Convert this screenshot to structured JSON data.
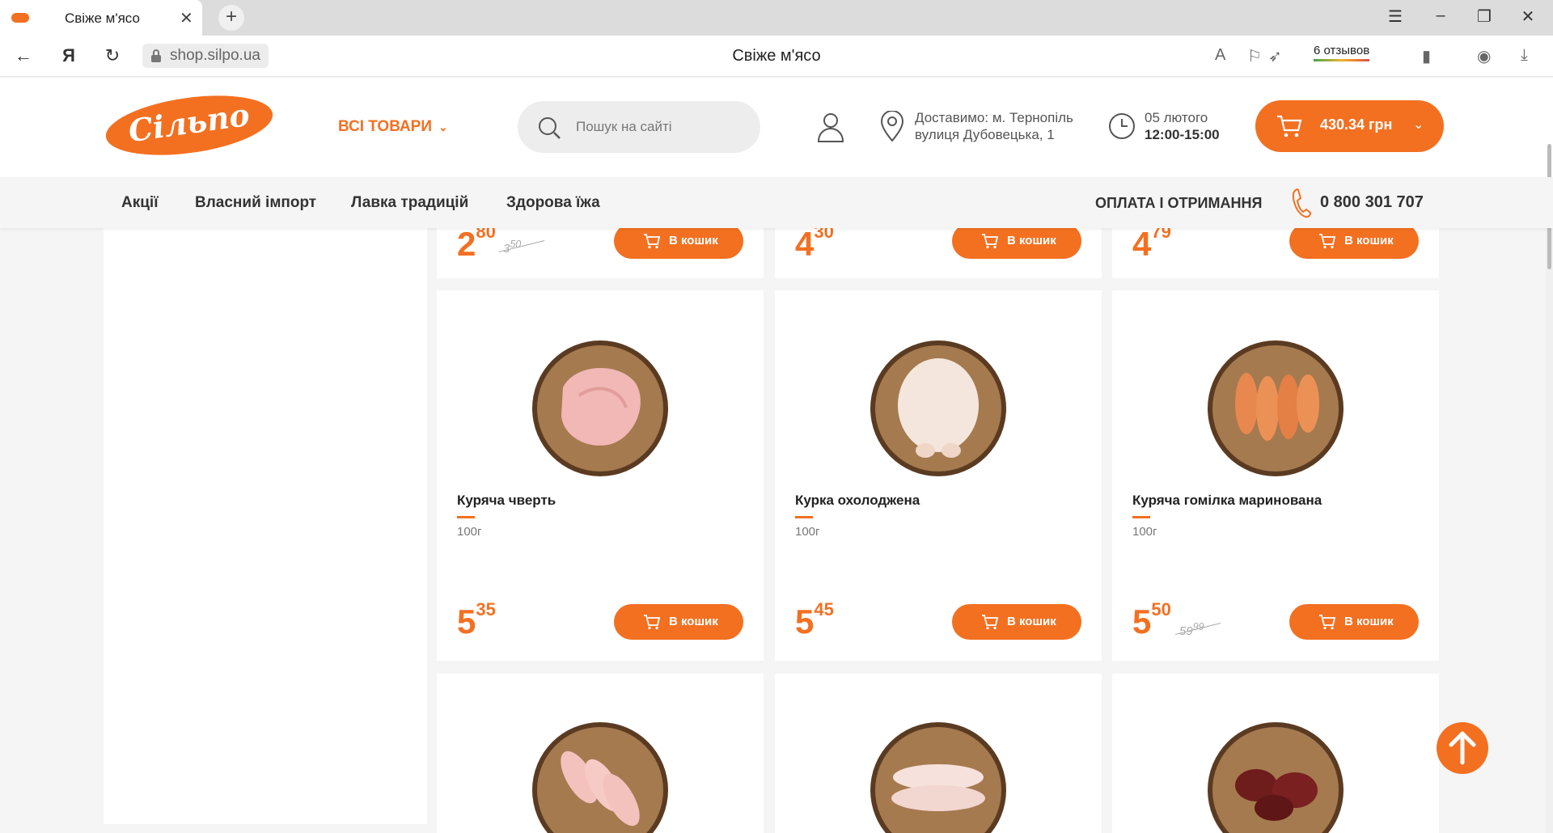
{
  "browser": {
    "tab_title": "Свіже м'ясо",
    "url": "shop.silpo.ua",
    "page_title": "Свіже м'ясо",
    "reviews": "6 отзывов"
  },
  "header": {
    "logo_text": "Сільпо",
    "all_goods": "ВСІ ТОВАРИ",
    "search_placeholder": "Пошук на сайті",
    "delivery_line1": "Доставимо: м. Тернопіль",
    "delivery_line2": "вулиця Дубовецька, 1",
    "date": "05 лютого",
    "time_slot": "12:00-15:00",
    "cart_total": "430.34 грн"
  },
  "menu": {
    "items": [
      "Акції",
      "Власний імпорт",
      "Лавка традицій",
      "Здорова їжа"
    ],
    "payment": "ОПЛАТА І ОТРИМАННЯ",
    "phone": "0 800 301 707"
  },
  "products": [
    {
      "name": "",
      "weight": "",
      "price_int": "2",
      "price_frac": "80",
      "old_int": "3",
      "old_frac": "50",
      "button": "В кошик"
    },
    {
      "name": "",
      "weight": "",
      "price_int": "4",
      "price_frac": "30",
      "old_int": "",
      "old_frac": "",
      "button": "В кошик"
    },
    {
      "name": "",
      "weight": "",
      "price_int": "4",
      "price_frac": "79",
      "old_int": "",
      "old_frac": "",
      "button": "В кошик"
    },
    {
      "name": "Куряча чверть",
      "weight": "100г",
      "price_int": "5",
      "price_frac": "35",
      "old_int": "",
      "old_frac": "",
      "button": "В кошик"
    },
    {
      "name": "Курка охолоджена",
      "weight": "100г",
      "price_int": "5",
      "price_frac": "45",
      "old_int": "",
      "old_frac": "",
      "button": "В кошик"
    },
    {
      "name": "Куряча гомілка маринована",
      "weight": "100г",
      "price_int": "5",
      "price_frac": "50",
      "old_int": "59",
      "old_frac": "99",
      "button": "В кошик"
    }
  ],
  "colors": {
    "brand": "#f37021"
  }
}
